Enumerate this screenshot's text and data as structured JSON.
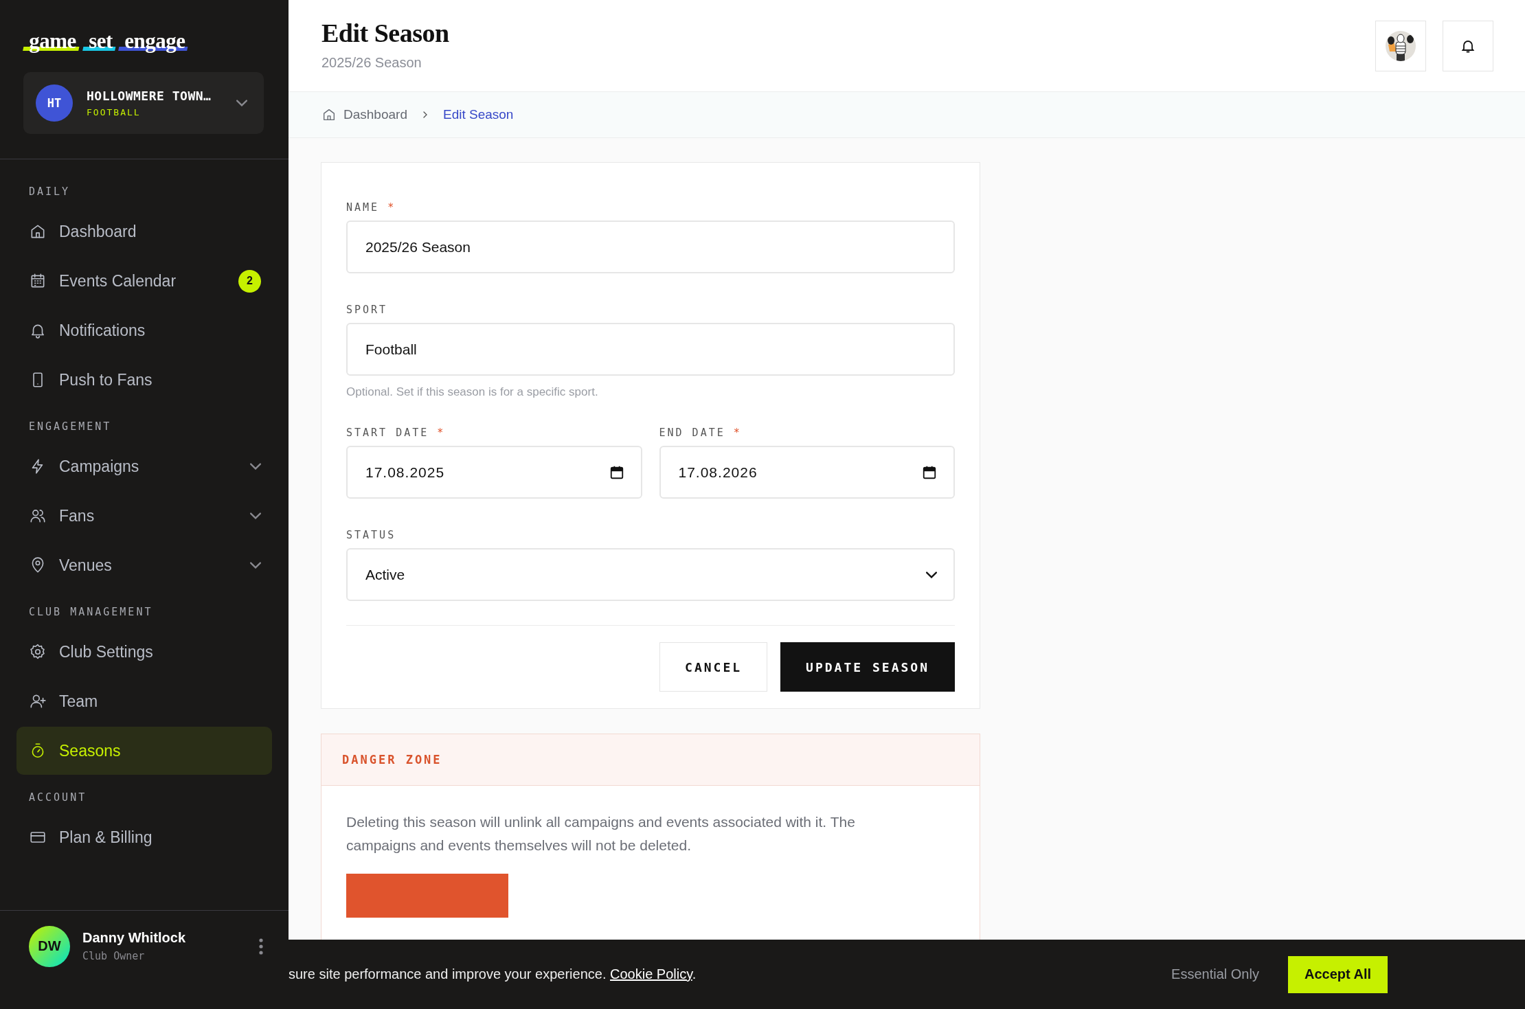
{
  "brand": {
    "words": [
      "game",
      "set",
      "engage"
    ]
  },
  "club": {
    "initials": "HT",
    "name": "HOLLOWMERE TOWN…",
    "sport": "FOOTBALL",
    "expanded": false
  },
  "sections": [
    {
      "title": "DAILY",
      "items": [
        {
          "label": "Dashboard",
          "selected": false
        },
        {
          "label": "Events Calendar",
          "selected": false,
          "badge": "2"
        },
        {
          "label": "Notifications",
          "selected": false
        },
        {
          "label": "Push to Fans",
          "selected": false
        }
      ]
    },
    {
      "title": "ENGAGEMENT",
      "items": [
        {
          "label": "Campaigns",
          "selected": false,
          "expanded": false
        },
        {
          "label": "Fans",
          "selected": false,
          "expanded": false
        },
        {
          "label": "Venues",
          "selected": false,
          "expanded": false
        }
      ]
    },
    {
      "title": "CLUB MANAGEMENT",
      "items": [
        {
          "label": "Club Settings",
          "selected": false
        },
        {
          "label": "Team",
          "selected": false
        },
        {
          "label": "Seasons",
          "selected": true
        }
      ]
    },
    {
      "title": "ACCOUNT",
      "items": [
        {
          "label": "Plan & Billing",
          "selected": false
        }
      ]
    }
  ],
  "user": {
    "initials": "DW",
    "name": "Danny Whitlock",
    "role": "Club Owner"
  },
  "header": {
    "title": "Edit Season",
    "subtitle": "2025/26 Season"
  },
  "breadcrumb": [
    {
      "label": "Dashboard",
      "selected": false
    },
    {
      "label": "Edit Season",
      "selected": true
    }
  ],
  "form": {
    "fields": [
      {
        "kind": "text",
        "label": "NAME",
        "mark": "*",
        "value": "2025/26 Season"
      },
      {
        "kind": "text",
        "label": "SPORT",
        "value": "Football",
        "hint": "Optional. Set if this season is for a specific sport."
      },
      {
        "kind": "date",
        "label": "START DATE",
        "mark": "*",
        "value": "17.08.2025"
      },
      {
        "kind": "date",
        "label": "END DATE",
        "mark": "*",
        "value": "17.08.2026"
      },
      {
        "kind": "select",
        "label": "STATUS",
        "value": "Active"
      }
    ],
    "cancel": "CANCEL",
    "submit": "UPDATE SEASON"
  },
  "danger": {
    "title": "DANGER ZONE",
    "text": "Deleting this season will unlink all campaigns and events associated with it. The campaigns and events themselves will not be deleted."
  },
  "cookie": {
    "text": "sure site performance and improve your experience.",
    "link": "Cookie Policy",
    "after": ".",
    "secondary": "Essential Only",
    "primary": "Accept All"
  }
}
